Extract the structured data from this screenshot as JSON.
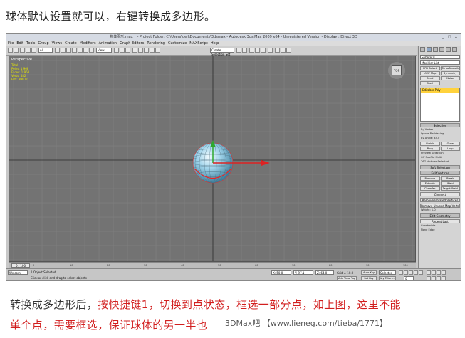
{
  "captions": {
    "top": "球体默认设置就可以，右键转换成多边形。",
    "bottom_prefix": "转换成多边形后，",
    "bottom_red_1": "按快捷键1，切换到点状态，框选一部分点，如上图，这里不能",
    "bottom_red_2": "单个点，需要框选，保证球体的另一半也",
    "watermark": "3DMax吧 【www.lieneg.com/tieba/1771】"
  },
  "window": {
    "doc_name": "物体图形.max",
    "title": "- Project Folder: C:\\Users\\dell\\Documents\\3dsmax   - Autodesk 3ds Max  2009 x64  - Unregistered Version   - Display : Direct 3D",
    "controls": "_ □ x"
  },
  "menu": [
    "File",
    "Edit",
    "Tools",
    "Group",
    "Views",
    "Create",
    "Modifiers",
    "Animation",
    "Graph Editors",
    "Rendering",
    "Customize",
    "MAXScript",
    "Help"
  ],
  "toolbar": {
    "filter": "All",
    "ref_coord": "View",
    "named_sel": "Create Selection Set"
  },
  "viewport": {
    "label": "Perspective",
    "stats": [
      "Total",
      "Polys: 1,968",
      "Faces: 1,968",
      "Verts: 482",
      "FPS:   999.00"
    ],
    "viewcube_label": "TOP"
  },
  "command_panel": {
    "object_name": "Sphere01",
    "modifier_list": "Modifier List",
    "buttons": [
      "FFD Select",
      "TurboSmooth",
      "UVW Map",
      "Symmetry",
      "Bend",
      "Noise",
      "Shell",
      ""
    ],
    "stack_item": "Editable Poly",
    "rollout_selection": "Selection",
    "sel_options": [
      "By Vertex",
      "Ignore Backfacing",
      "By Angle: 45.0"
    ],
    "shrink_grow": [
      "Shrink",
      "Grow"
    ],
    "ring_loop": [
      "Ring",
      "Loop"
    ],
    "preview_title": "Preview Selection",
    "preview_options": "Off    SubObj    Multi",
    "vertices_selected": "267 Vertices Selected",
    "rollout_soft": "Soft Selection",
    "rollout_edit_vertices": "Edit Vertices",
    "edit_buttons": [
      "Remove",
      "Break",
      "Extrude",
      "Weld",
      "Chamfer",
      "Target Weld"
    ],
    "connect": "Connect",
    "remove_isolated": "Remove Isolated Vertices",
    "remove_unused": "Remove Unused Map Verts",
    "weight_label": "Weight:",
    "weight_value": "1.0",
    "rollout_edit_geometry": "Edit Geometry",
    "repeat_last": "Repeat Last",
    "constraints": "Constraints",
    "constraint_options": "None    Edge"
  },
  "timeline": {
    "slider": "0 / 100",
    "ticks": [
      "0",
      "10",
      "20",
      "30",
      "40",
      "50",
      "60",
      "70",
      "80",
      "90",
      "100"
    ]
  },
  "status": {
    "maxscript": "Welcom",
    "objects_selected": "1 Object Selected",
    "prompt": "Click or click-and-drag to select objects",
    "x_value": "X: 50.0",
    "y_value": "Y: 97.1",
    "z_value": "Z: 64.0",
    "grid": "Grid = 10.0",
    "add_time_tag": "Add Time Tag",
    "auto_key": "Auto Key",
    "set_key": "Set Key",
    "selected_dropdown": "Selected",
    "key_filters": "Key Filters...",
    "frame": "0"
  }
}
